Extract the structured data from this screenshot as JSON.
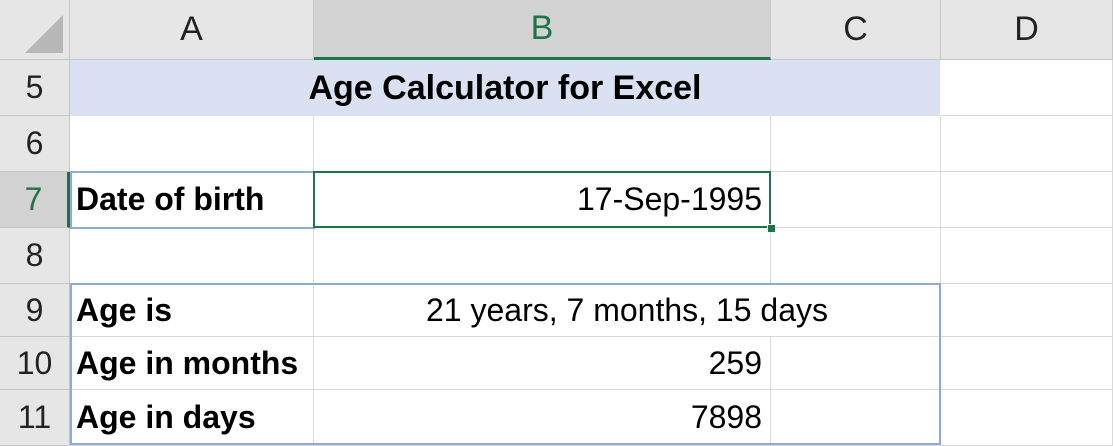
{
  "columns": [
    "A",
    "B",
    "C",
    "D"
  ],
  "rows": [
    "5",
    "6",
    "7",
    "8",
    "9",
    "10",
    "11"
  ],
  "title": "Age Calculator for Excel",
  "dob_label": "Date of birth",
  "dob_value": "17-Sep-1995",
  "results": [
    {
      "label": "Age is",
      "value": "21 years, 7 months, 15 days"
    },
    {
      "label": "Age in months",
      "value": "259"
    },
    {
      "label": "Age in days",
      "value": "7898"
    }
  ],
  "colors": {
    "selection": "#217346",
    "title_fill": "#d9e1f2",
    "frame": "#8ea9db"
  }
}
